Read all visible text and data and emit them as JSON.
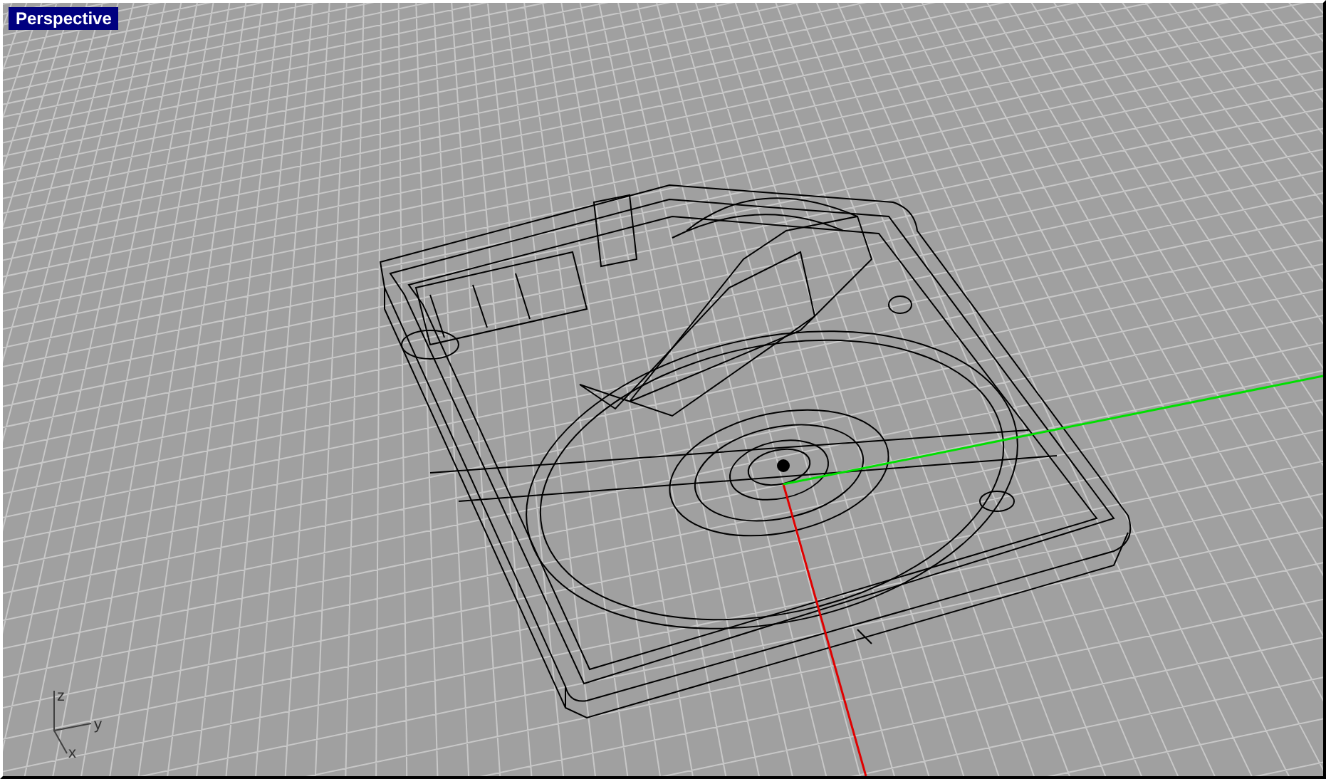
{
  "viewport": {
    "title": "Perspective"
  },
  "axis_icon": {
    "labels": [
      "z",
      "y",
      "x"
    ]
  }
}
